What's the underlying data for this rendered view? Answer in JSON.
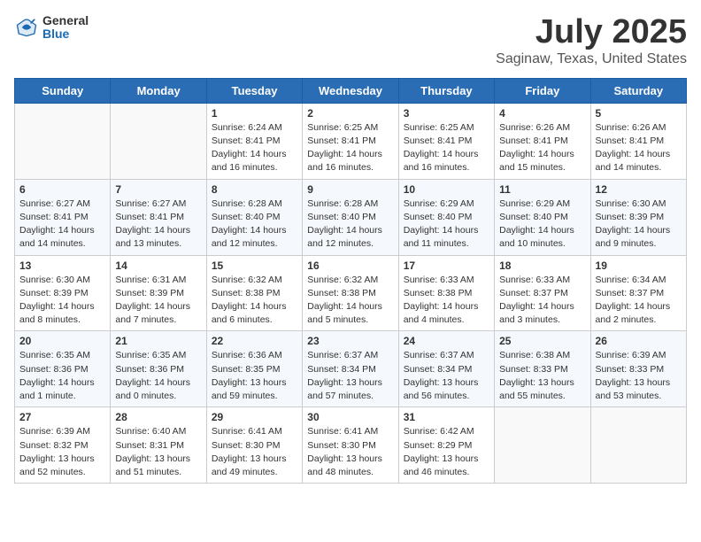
{
  "header": {
    "logo_general": "General",
    "logo_blue": "Blue",
    "title": "July 2025",
    "subtitle": "Saginaw, Texas, United States"
  },
  "days_of_week": [
    "Sunday",
    "Monday",
    "Tuesday",
    "Wednesday",
    "Thursday",
    "Friday",
    "Saturday"
  ],
  "weeks": [
    [
      {
        "day": "",
        "info": ""
      },
      {
        "day": "",
        "info": ""
      },
      {
        "day": "1",
        "info": "Sunrise: 6:24 AM\nSunset: 8:41 PM\nDaylight: 14 hours and 16 minutes."
      },
      {
        "day": "2",
        "info": "Sunrise: 6:25 AM\nSunset: 8:41 PM\nDaylight: 14 hours and 16 minutes."
      },
      {
        "day": "3",
        "info": "Sunrise: 6:25 AM\nSunset: 8:41 PM\nDaylight: 14 hours and 16 minutes."
      },
      {
        "day": "4",
        "info": "Sunrise: 6:26 AM\nSunset: 8:41 PM\nDaylight: 14 hours and 15 minutes."
      },
      {
        "day": "5",
        "info": "Sunrise: 6:26 AM\nSunset: 8:41 PM\nDaylight: 14 hours and 14 minutes."
      }
    ],
    [
      {
        "day": "6",
        "info": "Sunrise: 6:27 AM\nSunset: 8:41 PM\nDaylight: 14 hours and 14 minutes."
      },
      {
        "day": "7",
        "info": "Sunrise: 6:27 AM\nSunset: 8:41 PM\nDaylight: 14 hours and 13 minutes."
      },
      {
        "day": "8",
        "info": "Sunrise: 6:28 AM\nSunset: 8:40 PM\nDaylight: 14 hours and 12 minutes."
      },
      {
        "day": "9",
        "info": "Sunrise: 6:28 AM\nSunset: 8:40 PM\nDaylight: 14 hours and 12 minutes."
      },
      {
        "day": "10",
        "info": "Sunrise: 6:29 AM\nSunset: 8:40 PM\nDaylight: 14 hours and 11 minutes."
      },
      {
        "day": "11",
        "info": "Sunrise: 6:29 AM\nSunset: 8:40 PM\nDaylight: 14 hours and 10 minutes."
      },
      {
        "day": "12",
        "info": "Sunrise: 6:30 AM\nSunset: 8:39 PM\nDaylight: 14 hours and 9 minutes."
      }
    ],
    [
      {
        "day": "13",
        "info": "Sunrise: 6:30 AM\nSunset: 8:39 PM\nDaylight: 14 hours and 8 minutes."
      },
      {
        "day": "14",
        "info": "Sunrise: 6:31 AM\nSunset: 8:39 PM\nDaylight: 14 hours and 7 minutes."
      },
      {
        "day": "15",
        "info": "Sunrise: 6:32 AM\nSunset: 8:38 PM\nDaylight: 14 hours and 6 minutes."
      },
      {
        "day": "16",
        "info": "Sunrise: 6:32 AM\nSunset: 8:38 PM\nDaylight: 14 hours and 5 minutes."
      },
      {
        "day": "17",
        "info": "Sunrise: 6:33 AM\nSunset: 8:38 PM\nDaylight: 14 hours and 4 minutes."
      },
      {
        "day": "18",
        "info": "Sunrise: 6:33 AM\nSunset: 8:37 PM\nDaylight: 14 hours and 3 minutes."
      },
      {
        "day": "19",
        "info": "Sunrise: 6:34 AM\nSunset: 8:37 PM\nDaylight: 14 hours and 2 minutes."
      }
    ],
    [
      {
        "day": "20",
        "info": "Sunrise: 6:35 AM\nSunset: 8:36 PM\nDaylight: 14 hours and 1 minute."
      },
      {
        "day": "21",
        "info": "Sunrise: 6:35 AM\nSunset: 8:36 PM\nDaylight: 14 hours and 0 minutes."
      },
      {
        "day": "22",
        "info": "Sunrise: 6:36 AM\nSunset: 8:35 PM\nDaylight: 13 hours and 59 minutes."
      },
      {
        "day": "23",
        "info": "Sunrise: 6:37 AM\nSunset: 8:34 PM\nDaylight: 13 hours and 57 minutes."
      },
      {
        "day": "24",
        "info": "Sunrise: 6:37 AM\nSunset: 8:34 PM\nDaylight: 13 hours and 56 minutes."
      },
      {
        "day": "25",
        "info": "Sunrise: 6:38 AM\nSunset: 8:33 PM\nDaylight: 13 hours and 55 minutes."
      },
      {
        "day": "26",
        "info": "Sunrise: 6:39 AM\nSunset: 8:33 PM\nDaylight: 13 hours and 53 minutes."
      }
    ],
    [
      {
        "day": "27",
        "info": "Sunrise: 6:39 AM\nSunset: 8:32 PM\nDaylight: 13 hours and 52 minutes."
      },
      {
        "day": "28",
        "info": "Sunrise: 6:40 AM\nSunset: 8:31 PM\nDaylight: 13 hours and 51 minutes."
      },
      {
        "day": "29",
        "info": "Sunrise: 6:41 AM\nSunset: 8:30 PM\nDaylight: 13 hours and 49 minutes."
      },
      {
        "day": "30",
        "info": "Sunrise: 6:41 AM\nSunset: 8:30 PM\nDaylight: 13 hours and 48 minutes."
      },
      {
        "day": "31",
        "info": "Sunrise: 6:42 AM\nSunset: 8:29 PM\nDaylight: 13 hours and 46 minutes."
      },
      {
        "day": "",
        "info": ""
      },
      {
        "day": "",
        "info": ""
      }
    ]
  ]
}
